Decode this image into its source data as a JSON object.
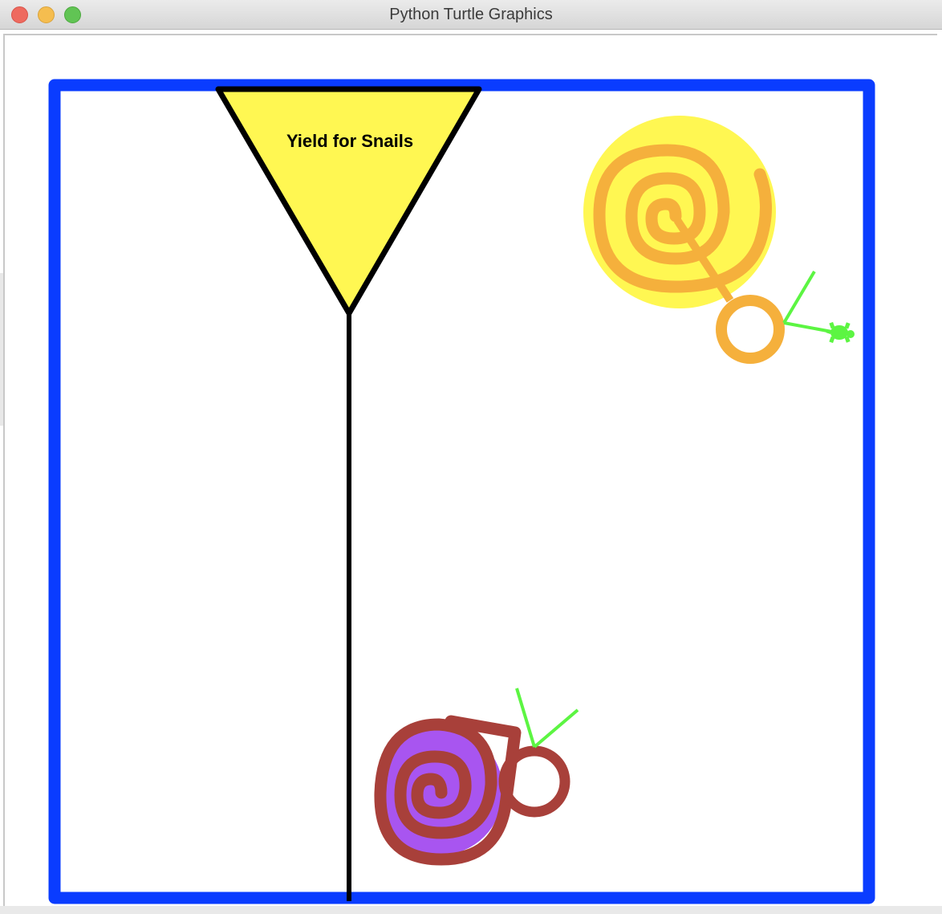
{
  "window": {
    "title": "Python Turtle Graphics"
  },
  "sign": {
    "text": "Yield for Snails",
    "fill_color": "#fff752",
    "stroke_color": "#000000"
  },
  "colors": {
    "border": "#0a3cff",
    "snail1_light": "#fff752",
    "snail1_dark": "#f5b03c",
    "snail2_light": "#a855f0",
    "snail2_dark": "#a8403a",
    "antenna": "#5cf542",
    "turtle": "#5cf542"
  },
  "icons": {
    "turtle": "turtle-icon"
  }
}
